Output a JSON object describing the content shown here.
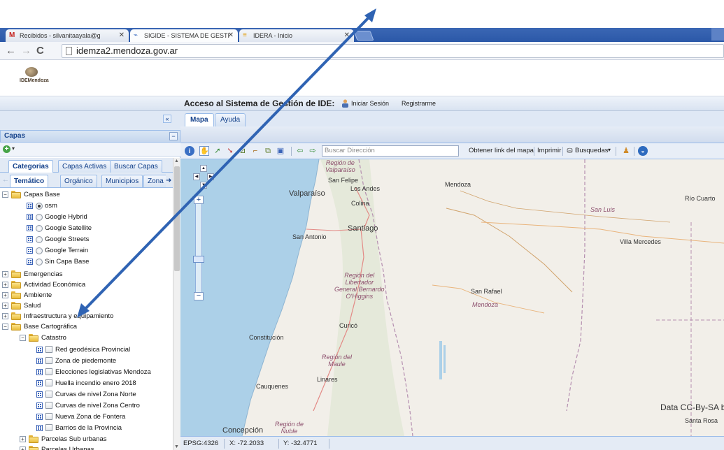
{
  "browser": {
    "tabs": [
      {
        "label": "Recibidos - silvanitaayala@g",
        "favicon": "gmail-icon"
      },
      {
        "label": "SIGIDE - SISTEMA DE GESTI",
        "favicon": "sigide-icon"
      },
      {
        "label": "IDERA - Inicio",
        "favicon": "idera-icon"
      }
    ],
    "url": "idemza2.mendoza.gov.ar"
  },
  "header": {
    "logo_text": "IDEMendoza"
  },
  "title_bar": {
    "title": "Acceso al Sistema de Gestión de IDE:",
    "login": "Iniciar Sesión",
    "register": "Registrarme"
  },
  "main_tabs": {
    "collapse": "«",
    "map": "Mapa",
    "help": "Ayuda"
  },
  "layers_panel": {
    "title": "Capas",
    "tabs_row1": [
      "Categorias",
      "Capas Activas",
      "Buscar Capas"
    ],
    "tabs_row2": [
      "Temático",
      "Orgánico",
      "Municipios",
      "Zona"
    ],
    "tree": {
      "base_layers": "Capas Base",
      "base_items": [
        "osm",
        "Google Hybrid",
        "Google Satellite",
        "Google Streets",
        "Google Terrain",
        "Sin Capa Base"
      ],
      "groups": [
        "Emergencias",
        "Actividad Económica",
        "Ambiente",
        "Salud",
        "Infraestructura y equipamiento",
        "Base Cartográfica"
      ],
      "catastro": "Catastro",
      "catastro_items": [
        "Red geodésica Provincial",
        "Zona de piedemonte",
        "Elecciones legislativas Mendoza",
        "Huella incendio enero 2018",
        "Curvas de nivel Zona Norte",
        "Curvas de nivel Zona Centro",
        "Nueva Zona de Fontera",
        "Barrios de la Provincia"
      ],
      "subgroups": [
        "Parcelas Sub urbanas",
        "Parcelas Urbanas"
      ]
    }
  },
  "map_toolbar": {
    "search_placeholder": "Buscar Dirección",
    "map_link": "Obtener link del mapa",
    "print": "Imprimir",
    "searches": "Busquedas"
  },
  "map": {
    "labels": {
      "valparaiso_region": "Región de\nValparaíso",
      "san_felipe": "San Felipe",
      "los_andes": "Los Andes",
      "valparaiso": "Valparaíso",
      "colina": "Colina",
      "santiago": "Santiago",
      "san_antonio": "San Antonio",
      "mendoza_city": "Mendoza",
      "rio_cuarto": "Río Cuarto",
      "san_luis": "San Luis",
      "villa_mercedes": "Villa Mercedes",
      "ohiggins_region": "Región del\nLibertador\nGeneral Bernardo\nO'Higgins",
      "san_rafael": "San Rafael",
      "mendoza_prov": "Mendoza",
      "curico": "Curicó",
      "constitucion": "Constitución",
      "maule_region": "Región del\nMaule",
      "linares": "Linares",
      "cauquenes": "Cauquenes",
      "concepcion": "Concepción",
      "nuble_region": "Región de\nÑuble",
      "santa_rosa": "Santa Rosa"
    },
    "attribution": "Data CC-By-SA by"
  },
  "status_bar": {
    "projection": "EPSG:4326",
    "x": "X: -72.2033",
    "y": "Y: -32.4771"
  },
  "colors": {
    "sea": "#acd0e8",
    "land": "#f2efe9",
    "annotation_arrow": "#2f63b3"
  }
}
